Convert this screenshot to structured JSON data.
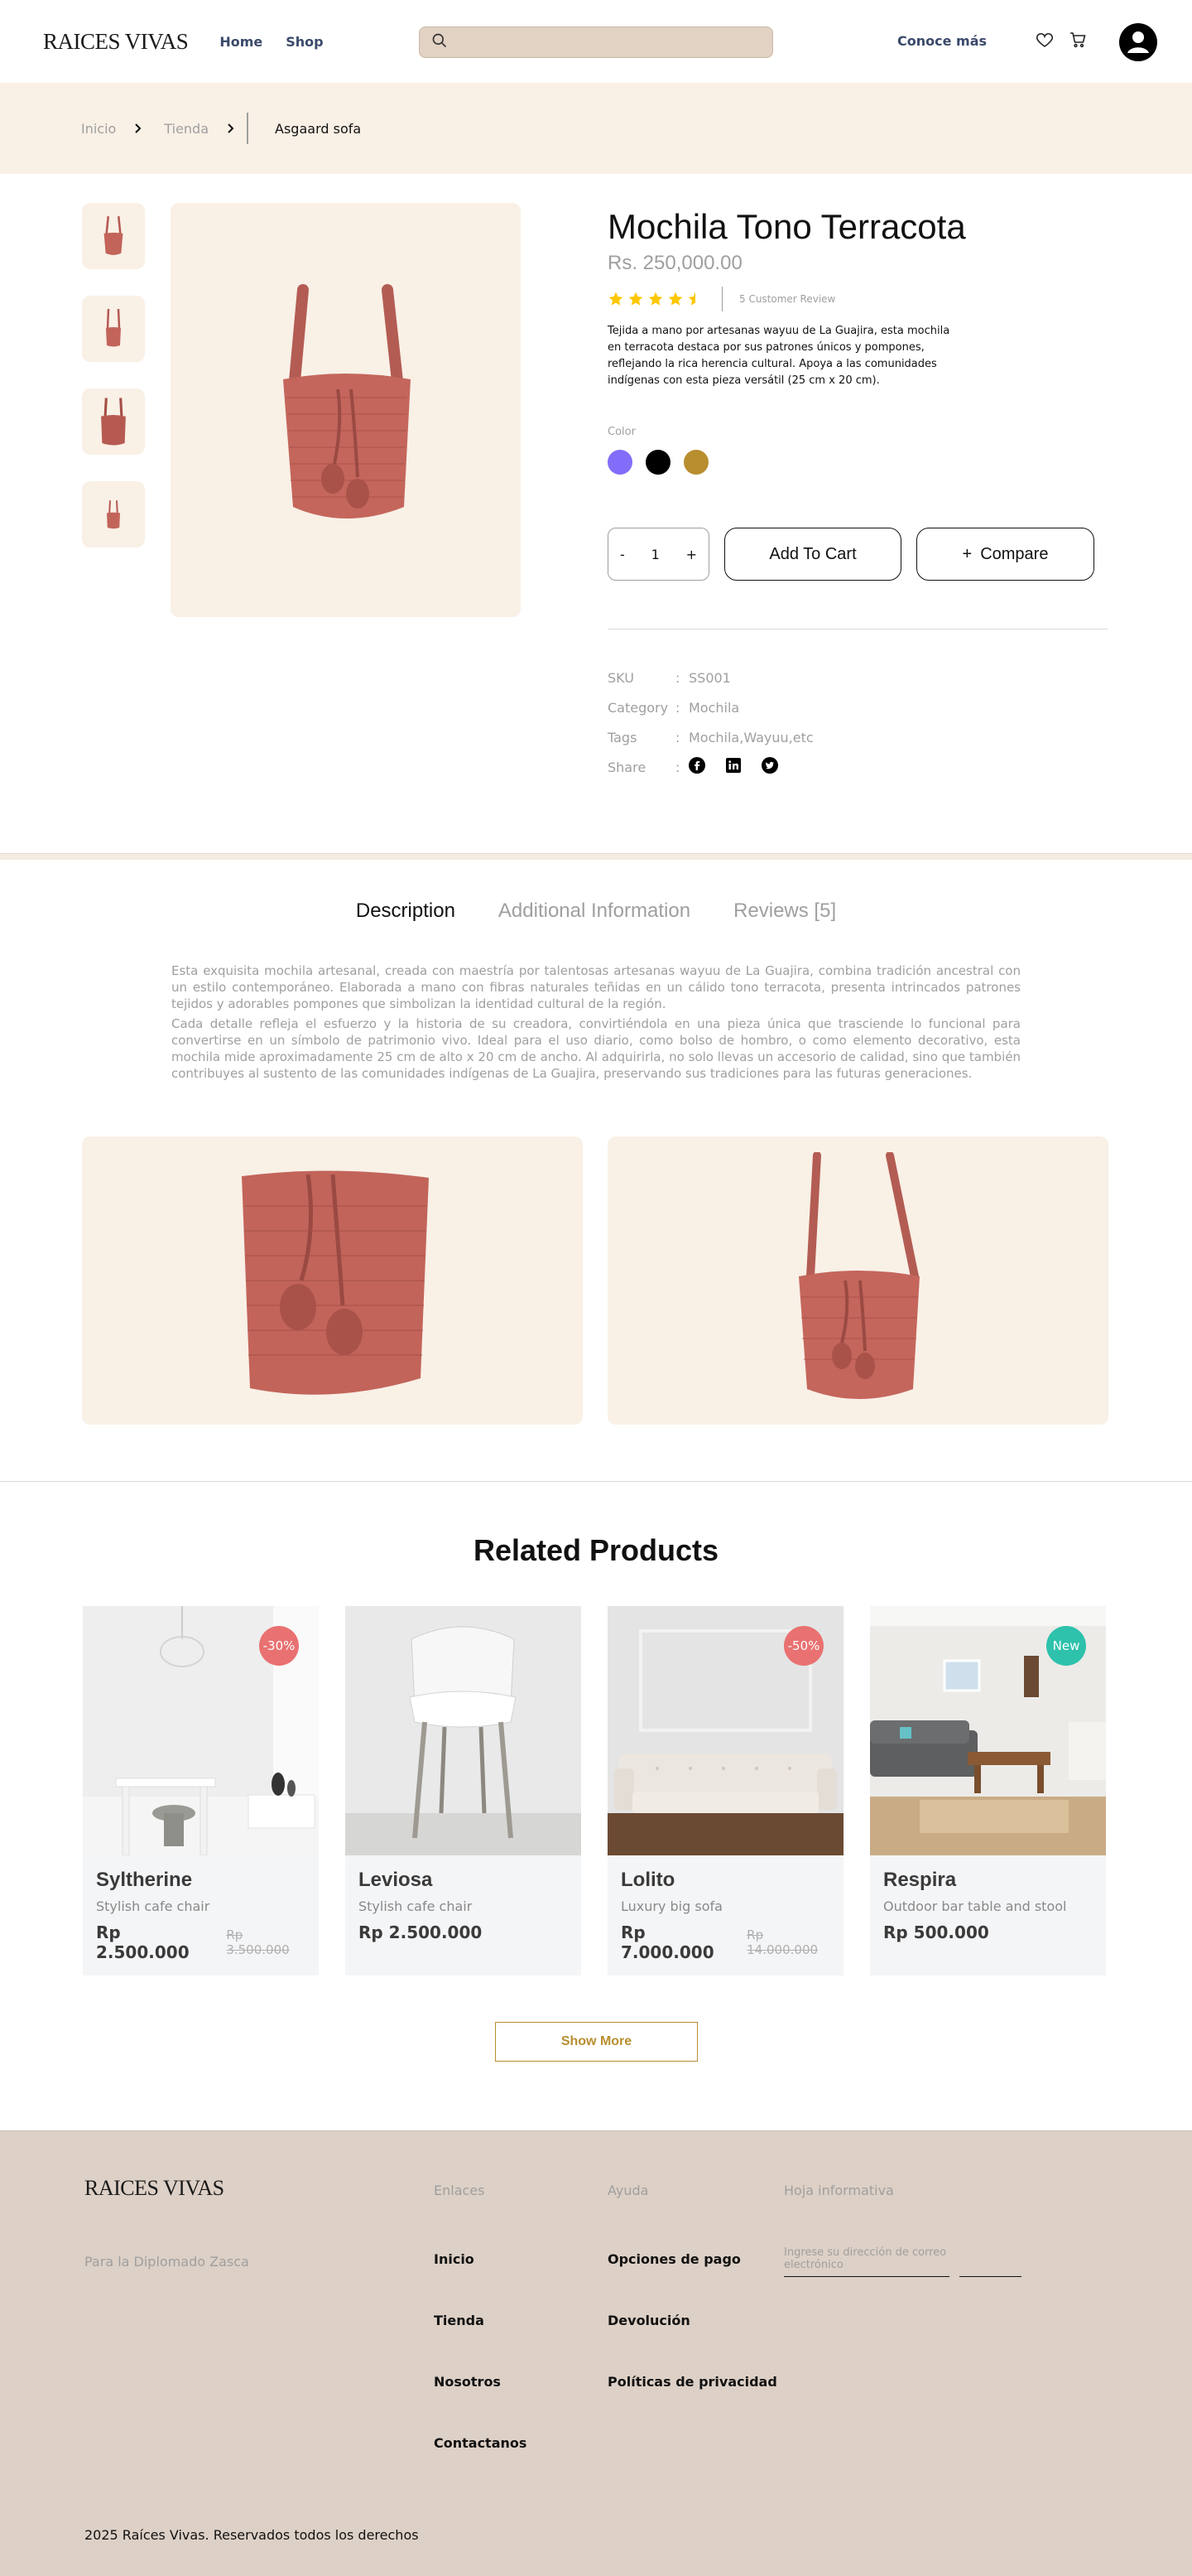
{
  "header": {
    "logo": "RAICES VIVAS",
    "nav": [
      "Home",
      "Shop"
    ],
    "search_placeholder": "",
    "conoce": "Conoce más"
  },
  "breadcrumb": {
    "items": [
      "Inicio",
      "Tienda"
    ],
    "current": "Asgaard sofa"
  },
  "product": {
    "title": "Mochila Tono Terracota",
    "price": "Rs. 250,000.00",
    "rating": 4.5,
    "review_count": "5 Customer Review",
    "description": "Tejida a mano por artesanas wayuu de La Guajira, esta mochila en terracota destaca por sus patrones únicos y pompones, reflejando la rica herencia cultural. Apoya a las comunidades indígenas con esta pieza versátil (25 cm x 20 cm).",
    "color_label": "Color",
    "colors": [
      "#816dfa",
      "#000000",
      "#b88e2f"
    ],
    "qty_minus": "-",
    "qty": "1",
    "qty_plus": "+",
    "add_to_cart": "Add To Cart",
    "compare": "Compare",
    "compare_prefix": "+",
    "meta": {
      "sku_key": "SKU",
      "sku": "SS001",
      "category_key": "Category",
      "category": "Mochila",
      "tags_key": "Tags",
      "tags": "Mochila,Wayuu,etc",
      "share_key": "Share",
      "colon": ":"
    }
  },
  "tabs": {
    "items": [
      "Description",
      "Additional Information",
      "Reviews [5]"
    ],
    "active": 0,
    "paragraph1": "Esta exquisita mochila artesanal, creada con maestría por talentosas artesanas wayuu de La Guajira, combina tradición ancestral con un estilo contemporáneo. Elaborada a mano con fibras naturales teñidas en un cálido tono terracota, presenta intrincados patrones tejidos y adorables pompones que simbolizan la identidad cultural de la región.",
    "paragraph2": "Cada detalle refleja el esfuerzo y la historia de su creadora, convirtiéndola en una pieza única que trasciende lo funcional para convertirse en un símbolo de patrimonio vivo. Ideal para el uso diario, como bolso de hombro, o como elemento decorativo, esta mochila mide aproximadamente 25 cm de alto x 20 cm de ancho. Al adquirirla, no solo llevas un accesorio de calidad, sino que también contribuyes al sustento de las comunidades indígenas de La Guajira, preservando sus tradiciones para las futuras generaciones."
  },
  "related": {
    "title": "Related Products",
    "cards": [
      {
        "name": "Syltherine",
        "sub": "Stylish cafe chair",
        "price": "Rp 2.500.000",
        "old": "Rp 3.500.000",
        "badge": "-30%",
        "badge_color": "#e97171"
      },
      {
        "name": "Leviosa",
        "sub": "Stylish cafe chair",
        "price": "Rp 2.500.000",
        "old": "",
        "badge": "",
        "badge_color": ""
      },
      {
        "name": "Lolito",
        "sub": "Luxury big sofa",
        "price": "Rp 7.000.000",
        "old": "Rp 14.000.000",
        "badge": "-50%",
        "badge_color": "#e97171"
      },
      {
        "name": "Respira",
        "sub": "Outdoor bar table and stool",
        "price": "Rp 500.000",
        "old": "",
        "badge": "New",
        "badge_color": "#2ec1ac"
      }
    ],
    "show_more": "Show More"
  },
  "footer": {
    "logo": "RAICES VIVAS",
    "tagline": "Para la Diplomado Zasca",
    "col1_head": "Enlaces",
    "col1": [
      "Inicio",
      "Tienda",
      "Nosotros",
      "Contactanos"
    ],
    "col2_head": "Ayuda",
    "col2": [
      "Opciones de pago",
      "Devolución",
      "Políticas de privacidad"
    ],
    "news_head": "Hoja informativa",
    "email_placeholder": "Ingrese su dirección de correo electrónico",
    "subscribe": "",
    "copyright": "2025 Raíces Vivas. Reservados todos los derechos"
  }
}
